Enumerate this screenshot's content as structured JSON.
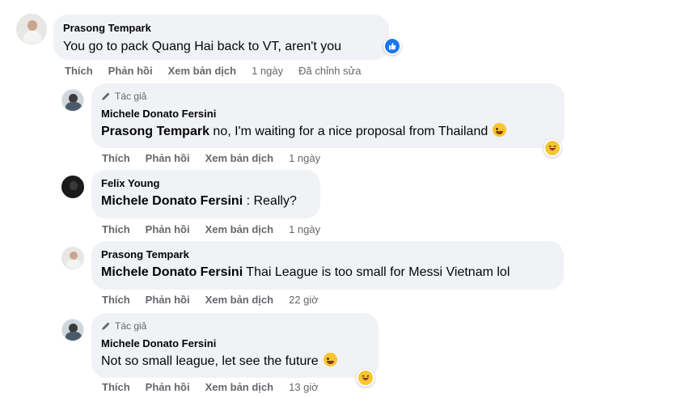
{
  "comments": [
    {
      "author": "Prasong Tempark",
      "text": "You go to pack Quang Hai back to VT, aren't you",
      "actions": [
        "Thích",
        "Phản hồi",
        "Xem bản dịch"
      ],
      "time": "1 ngày",
      "edited": "Đã chỉnh sửa",
      "reaction": "like-icon"
    },
    {
      "author_tag": "Tác giả",
      "author": "Michele Donato Fersini",
      "mention": "Prasong Tempark",
      "text": " no, I'm waiting for a nice proposal from Thailand",
      "actions": [
        "Thích",
        "Phản hồi",
        "Xem bản dịch"
      ],
      "time": "1 ngày",
      "reaction": "laughing-emoji-icon"
    },
    {
      "author": "Felix Young",
      "mention": "Michele Donato Fersini",
      "text": " : Really?",
      "actions": [
        "Thích",
        "Phản hồi",
        "Xem bản dịch"
      ],
      "time": "1 ngày"
    },
    {
      "author": "Prasong Tempark",
      "mention": "Michele Donato Fersini",
      "text": " Thai League is too small for Messi Vietnam lol",
      "actions": [
        "Thích",
        "Phản hồi",
        "Xem bản dịch"
      ],
      "time": "22 giờ"
    },
    {
      "author_tag": "Tác giả",
      "author": "Michele Donato Fersini",
      "text": "Not so small league, let see the future",
      "actions": [
        "Thích",
        "Phản hồi",
        "Xem bản dịch"
      ],
      "time": "13 giờ",
      "reaction": "laughing-emoji-icon"
    }
  ],
  "colors": {
    "bubble": "#f0f2f5",
    "meta_text": "#65676b",
    "like_blue": "#1877f2",
    "emoji_yellow": "#f7c531"
  }
}
